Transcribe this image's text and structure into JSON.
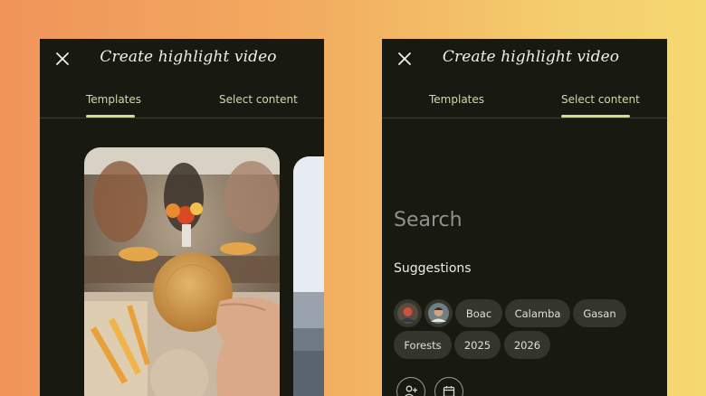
{
  "left_screen": {
    "title": "Create highlight video",
    "tabs": [
      {
        "label": "Templates",
        "active": true
      },
      {
        "label": "Select content",
        "active": false
      }
    ]
  },
  "right_screen": {
    "title": "Create highlight video",
    "tabs": [
      {
        "label": "Templates",
        "active": false
      },
      {
        "label": "Select content",
        "active": true
      }
    ],
    "search_placeholder": "Search",
    "suggestions_heading": "Suggestions",
    "person_chips": [
      "person-avatar-1",
      "person-avatar-2"
    ],
    "chips_row1": [
      "Boac",
      "Calamba",
      "Gasan"
    ],
    "chips_row2": [
      "Forests",
      "2025",
      "2026"
    ],
    "bottom_actions": [
      "add-person-icon",
      "calendar-icon"
    ]
  },
  "colors": {
    "background_left": "#f0945a",
    "background_right": "#f5d870",
    "screen_bg": "#181a12",
    "accent": "#cfe08a",
    "chip_bg": "#34362d"
  }
}
